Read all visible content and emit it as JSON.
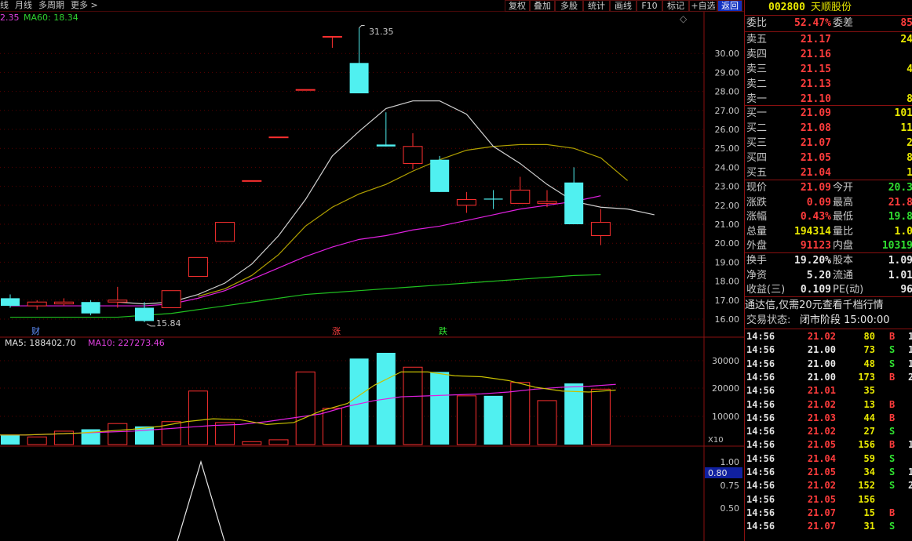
{
  "toolbar": {
    "nav": [
      "线",
      "月线",
      "多周期",
      "更多 >"
    ],
    "buttons": [
      "复权",
      "叠加",
      "多股",
      "统计",
      "画线",
      "F10",
      "标记",
      "+自选",
      "返回"
    ]
  },
  "main": {
    "ma_legend": {
      "ma_prev": "2.35",
      "ma60_label": "MA60: 18.34"
    },
    "price_axis": [
      "30.00",
      "29.00",
      "28.00",
      "27.00",
      "26.00",
      "25.00",
      "24.00",
      "23.00",
      "22.00",
      "21.00",
      "20.00",
      "19.00",
      "18.00",
      "17.00",
      "16.00"
    ],
    "high_label": "31.35",
    "low_label": "15.84",
    "markers": {
      "cai": "财",
      "zhang": "涨",
      "die": "跌"
    },
    "diamond": "◇"
  },
  "volume": {
    "legend": {
      "ma5": "MA5: 188402.70",
      "ma10": "MA10: 227273.46"
    },
    "axis": [
      "30000",
      "20000",
      "10000"
    ],
    "unit": "X10"
  },
  "indicator": {
    "axis": [
      "1.00",
      "0.75",
      "0.50"
    ],
    "current": "0.80"
  },
  "chart_data": {
    "type": "candlestick",
    "candles": [
      {
        "o": 17.1,
        "c": 16.7,
        "h": 17.3,
        "l": 16.6
      },
      {
        "o": 16.7,
        "c": 16.9,
        "h": 17.0,
        "l": 16.5
      },
      {
        "o": 16.8,
        "c": 16.9,
        "h": 17.1,
        "l": 16.7
      },
      {
        "o": 16.9,
        "c": 16.3,
        "h": 17.0,
        "l": 16.2
      },
      {
        "o": 16.9,
        "c": 17.0,
        "h": 17.7,
        "l": 16.6
      },
      {
        "o": 16.6,
        "c": 15.9,
        "h": 16.9,
        "l": 15.84
      },
      {
        "o": 16.6,
        "c": 17.5,
        "h": 17.5,
        "l": 16.6
      },
      {
        "o": 18.25,
        "c": 19.25,
        "h": 19.25,
        "l": 18.25
      },
      {
        "o": 20.1,
        "c": 21.1,
        "h": 21.1,
        "l": 20.1
      },
      {
        "o": 23.3,
        "c": 23.3,
        "h": 23.3,
        "l": 23.3
      },
      {
        "o": 25.6,
        "c": 25.6,
        "h": 25.6,
        "l": 25.6
      },
      {
        "o": 28.1,
        "c": 28.1,
        "h": 28.1,
        "l": 28.1
      },
      {
        "o": 30.9,
        "c": 30.9,
        "h": 30.9,
        "l": 30.3
      },
      {
        "o": 29.5,
        "c": 27.9,
        "h": 31.35,
        "l": 27.9
      },
      {
        "o": 25.2,
        "c": 25.1,
        "h": 26.9,
        "l": 25.1
      },
      {
        "o": 24.2,
        "c": 25.1,
        "h": 25.8,
        "l": 23.9
      },
      {
        "o": 24.4,
        "c": 22.7,
        "h": 24.6,
        "l": 22.7
      },
      {
        "o": 22.0,
        "c": 22.3,
        "h": 22.7,
        "l": 21.6
      },
      {
        "o": 22.35,
        "c": 22.3,
        "h": 22.8,
        "l": 21.8
      },
      {
        "o": 22.1,
        "c": 22.8,
        "h": 23.5,
        "l": 22.1
      },
      {
        "o": 22.1,
        "c": 22.2,
        "h": 22.8,
        "l": 21.9
      },
      {
        "o": 23.2,
        "c": 21.0,
        "h": 24.0,
        "l": 21.0
      },
      {
        "o": 20.4,
        "c": 21.1,
        "h": 21.8,
        "l": 19.9
      }
    ],
    "volume": [
      1.0,
      0.8,
      1.4,
      1.6,
      2.2,
      1.9,
      2.4,
      5.6,
      2.3,
      0.3,
      0.5,
      7.6,
      3.8,
      9.0,
      9.6,
      8.1,
      7.6,
      5.1,
      5.1,
      6.5,
      4.6,
      6.4,
      5.8
    ],
    "ma_white": [
      null,
      null,
      null,
      null,
      16.9,
      16.8,
      16.9,
      17.3,
      17.9,
      18.9,
      20.4,
      22.3,
      24.6,
      25.9,
      27.1,
      27.5,
      27.5,
      26.8,
      25.1,
      24.2,
      23.1,
      22.2,
      21.9,
      21.8,
      21.5
    ],
    "ma_yellow": [
      null,
      null,
      null,
      null,
      null,
      null,
      null,
      17.2,
      17.6,
      18.3,
      19.4,
      20.9,
      21.9,
      22.6,
      23.1,
      23.8,
      24.4,
      24.9,
      25.1,
      25.2,
      25.2,
      25.0,
      24.5,
      23.3
    ],
    "ma_magenta": [
      16.7,
      16.7,
      16.7,
      16.7,
      16.7,
      16.7,
      16.8,
      17.1,
      17.5,
      18.1,
      18.7,
      19.3,
      19.8,
      20.2,
      20.4,
      20.7,
      20.9,
      21.2,
      21.5,
      21.8,
      22.0,
      22.2,
      22.5
    ],
    "ma_green": [
      16.1,
      16.1,
      16.1,
      16.1,
      16.1,
      16.2,
      16.3,
      16.5,
      16.7,
      16.9,
      17.1,
      17.3,
      17.4,
      17.5,
      17.6,
      17.7,
      17.8,
      17.9,
      18.0,
      18.1,
      18.2,
      18.3,
      18.34
    ],
    "vol_ma5": [
      1.0,
      1.0,
      1.1,
      1.2,
      1.4,
      1.6,
      1.9,
      2.4,
      2.7,
      2.6,
      2.1,
      2.3,
      3.5,
      4.3,
      6.2,
      7.6,
      7.6,
      7.2,
      7.1,
      6.7,
      6.0,
      5.6,
      5.5,
      5.7
    ],
    "vol_ma10": [
      1.0,
      1.0,
      1.1,
      1.2,
      1.3,
      1.4,
      1.6,
      1.8,
      2.0,
      2.1,
      2.4,
      2.8,
      3.2,
      4.0,
      4.6,
      5.0,
      5.1,
      5.2,
      5.3,
      5.5,
      5.8,
      6.0,
      6.1,
      6.3
    ]
  },
  "panel": {
    "code": "002800",
    "name": "天顺股份",
    "webi": {
      "label": "委比",
      "value": "52.47%",
      "label2": "委差",
      "value2": "85"
    },
    "sells": [
      {
        "label": "卖五",
        "price": "21.17",
        "vol": "24"
      },
      {
        "label": "卖四",
        "price": "21.16",
        "vol": ""
      },
      {
        "label": "卖三",
        "price": "21.15",
        "vol": "4"
      },
      {
        "label": "卖二",
        "price": "21.13",
        "vol": ""
      },
      {
        "label": "卖一",
        "price": "21.10",
        "vol": "8"
      }
    ],
    "buys": [
      {
        "label": "买一",
        "price": "21.09",
        "vol": "101"
      },
      {
        "label": "买二",
        "price": "21.08",
        "vol": "11"
      },
      {
        "label": "买三",
        "price": "21.07",
        "vol": "2"
      },
      {
        "label": "买四",
        "price": "21.05",
        "vol": "8"
      },
      {
        "label": "买五",
        "price": "21.04",
        "vol": "1"
      }
    ],
    "quote": [
      {
        "l1": "现价",
        "v1": "21.09",
        "c1": "red",
        "l2": "今开",
        "v2": "20.3",
        "c2": "green"
      },
      {
        "l1": "涨跌",
        "v1": "0.09",
        "c1": "red",
        "l2": "最高",
        "v2": "21.8",
        "c2": "red"
      },
      {
        "l1": "涨幅",
        "v1": "0.43%",
        "c1": "red",
        "l2": "最低",
        "v2": "19.8",
        "c2": "green"
      },
      {
        "l1": "总量",
        "v1": "194314",
        "c1": "yellow",
        "l2": "量比",
        "v2": "1.0",
        "c2": "yellow"
      },
      {
        "l1": "外盘",
        "v1": "91123",
        "c1": "red",
        "l2": "内盘",
        "v2": "10319",
        "c2": "green"
      }
    ],
    "stats": [
      {
        "l1": "换手",
        "v1": "19.20%",
        "l2": "股本",
        "v2": "1.09"
      },
      {
        "l1": "净资",
        "v1": "5.20",
        "l2": "流通",
        "v2": "1.01"
      },
      {
        "l1": "收益(三)",
        "v1": "0.109",
        "l2": "PE(动)",
        "v2": "96"
      }
    ],
    "promo": "通达信,仅需20元查看千档行情",
    "trade_status_label": "交易状态:",
    "trade_status": "闭市阶段 15:00:00",
    "ticks": [
      {
        "t": "14:56",
        "p": "21.02",
        "pc": "red",
        "v": "80",
        "s": "B",
        "x": "1"
      },
      {
        "t": "14:56",
        "p": "21.00",
        "pc": "white",
        "v": "73",
        "s": "S",
        "x": "1"
      },
      {
        "t": "14:56",
        "p": "21.00",
        "pc": "white",
        "v": "48",
        "s": "S",
        "x": "1"
      },
      {
        "t": "14:56",
        "p": "21.00",
        "pc": "white",
        "v": "173",
        "s": "B",
        "x": "2"
      },
      {
        "t": "14:56",
        "p": "21.01",
        "pc": "red",
        "v": "35",
        "s": "",
        "x": ""
      },
      {
        "t": "14:56",
        "p": "21.02",
        "pc": "red",
        "v": "13",
        "s": "B",
        "x": ""
      },
      {
        "t": "14:56",
        "p": "21.03",
        "pc": "red",
        "v": "44",
        "s": "B",
        "x": ""
      },
      {
        "t": "14:56",
        "p": "21.02",
        "pc": "red",
        "v": "27",
        "s": "S",
        "x": ""
      },
      {
        "t": "14:56",
        "p": "21.05",
        "pc": "red",
        "v": "156",
        "s": "B",
        "x": "1"
      },
      {
        "t": "14:56",
        "p": "21.04",
        "pc": "red",
        "v": "59",
        "s": "S",
        "x": ""
      },
      {
        "t": "14:56",
        "p": "21.05",
        "pc": "red",
        "v": "34",
        "s": "S",
        "x": "1"
      },
      {
        "t": "14:56",
        "p": "21.02",
        "pc": "red",
        "v": "152",
        "s": "S",
        "x": "2"
      },
      {
        "t": "14:56",
        "p": "21.05",
        "pc": "red",
        "v": "156",
        "s": "",
        "x": ""
      },
      {
        "t": "14:56",
        "p": "21.07",
        "pc": "red",
        "v": "15",
        "s": "B",
        "x": ""
      },
      {
        "t": "14:56",
        "p": "21.07",
        "pc": "red",
        "v": "31",
        "s": "S",
        "x": ""
      }
    ]
  }
}
